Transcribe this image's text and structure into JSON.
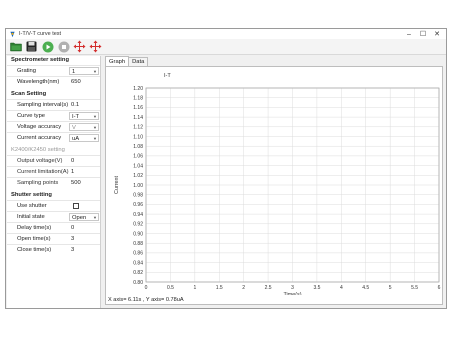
{
  "window": {
    "title": "I-T/V-T curve test",
    "controls": {
      "minimize": "–",
      "maximize": "☐",
      "close": "✕"
    }
  },
  "toolbar": {
    "buttons": [
      {
        "name": "open-folder-icon",
        "color": "#2e7d32"
      },
      {
        "name": "save-icon",
        "color": "#222222"
      },
      {
        "name": "play-icon",
        "color": "#4caf50"
      },
      {
        "name": "stop-icon",
        "color": "#b0b0b0"
      },
      {
        "name": "move-arrows-icon",
        "color": "#d32f2f"
      },
      {
        "name": "move-arrows-icon-2",
        "color": "#d32f2f"
      }
    ]
  },
  "sections": {
    "spectrometer": {
      "title": "Spectrometer setting",
      "grating": {
        "label": "Grating",
        "value": "1"
      },
      "wavelength": {
        "label": "Wavelength(nm)",
        "value": "650"
      }
    },
    "scan": {
      "title": "Scan Setting",
      "interval": {
        "label": "Sampling interval(s)",
        "value": "0.1"
      },
      "curve_type": {
        "label": "Curve type",
        "value": "I-T"
      },
      "voltage_accuracy": {
        "label": "Voltage accuracy",
        "value": "V"
      },
      "current_accuracy": {
        "label": "Current accuracy",
        "value": "uA"
      }
    },
    "k2400": {
      "title": "K2400/K2450 setting",
      "output_voltage": {
        "label": "Output voltage(V)",
        "value": "0"
      },
      "current_limit": {
        "label": "Current limitation(A)",
        "value": "1"
      },
      "sampling_points": {
        "label": "Sampling points",
        "value": "500"
      }
    },
    "shutter": {
      "title": "Shutter setting",
      "use_shutter": {
        "label": "Use shutter",
        "checked": false
      },
      "initial_state": {
        "label": "Initial state",
        "value": "Open"
      },
      "delay_time": {
        "label": "Delay time(s)",
        "value": "0"
      },
      "open_time": {
        "label": "Open time(s)",
        "value": "3"
      },
      "close_time": {
        "label": "Close time(s)",
        "value": "3"
      }
    }
  },
  "tabs": [
    {
      "label": "Graph",
      "active": true
    },
    {
      "label": "Data",
      "active": false
    }
  ],
  "readout": "X axis= 6.11s , Y axis= 0.78uA",
  "chart_data": {
    "type": "line",
    "title": "I-T",
    "xlabel": "Time(s)",
    "ylabel": "Current",
    "xlim": [
      0,
      6
    ],
    "ylim": [
      0.8,
      1.2
    ],
    "x_ticks": [
      "0",
      "0.5",
      "1",
      "1.5",
      "2",
      "2.5",
      "3",
      "3.5",
      "4",
      "4.5",
      "5",
      "5.5",
      "6"
    ],
    "y_ticks": [
      "0.80",
      "0.82",
      "0.84",
      "0.86",
      "0.88",
      "0.90",
      "0.92",
      "0.94",
      "0.96",
      "0.98",
      "1.00",
      "1.02",
      "1.04",
      "1.06",
      "1.08",
      "1.10",
      "1.12",
      "1.14",
      "1.16",
      "1.18",
      "1.20"
    ],
    "grid": true,
    "series": []
  }
}
